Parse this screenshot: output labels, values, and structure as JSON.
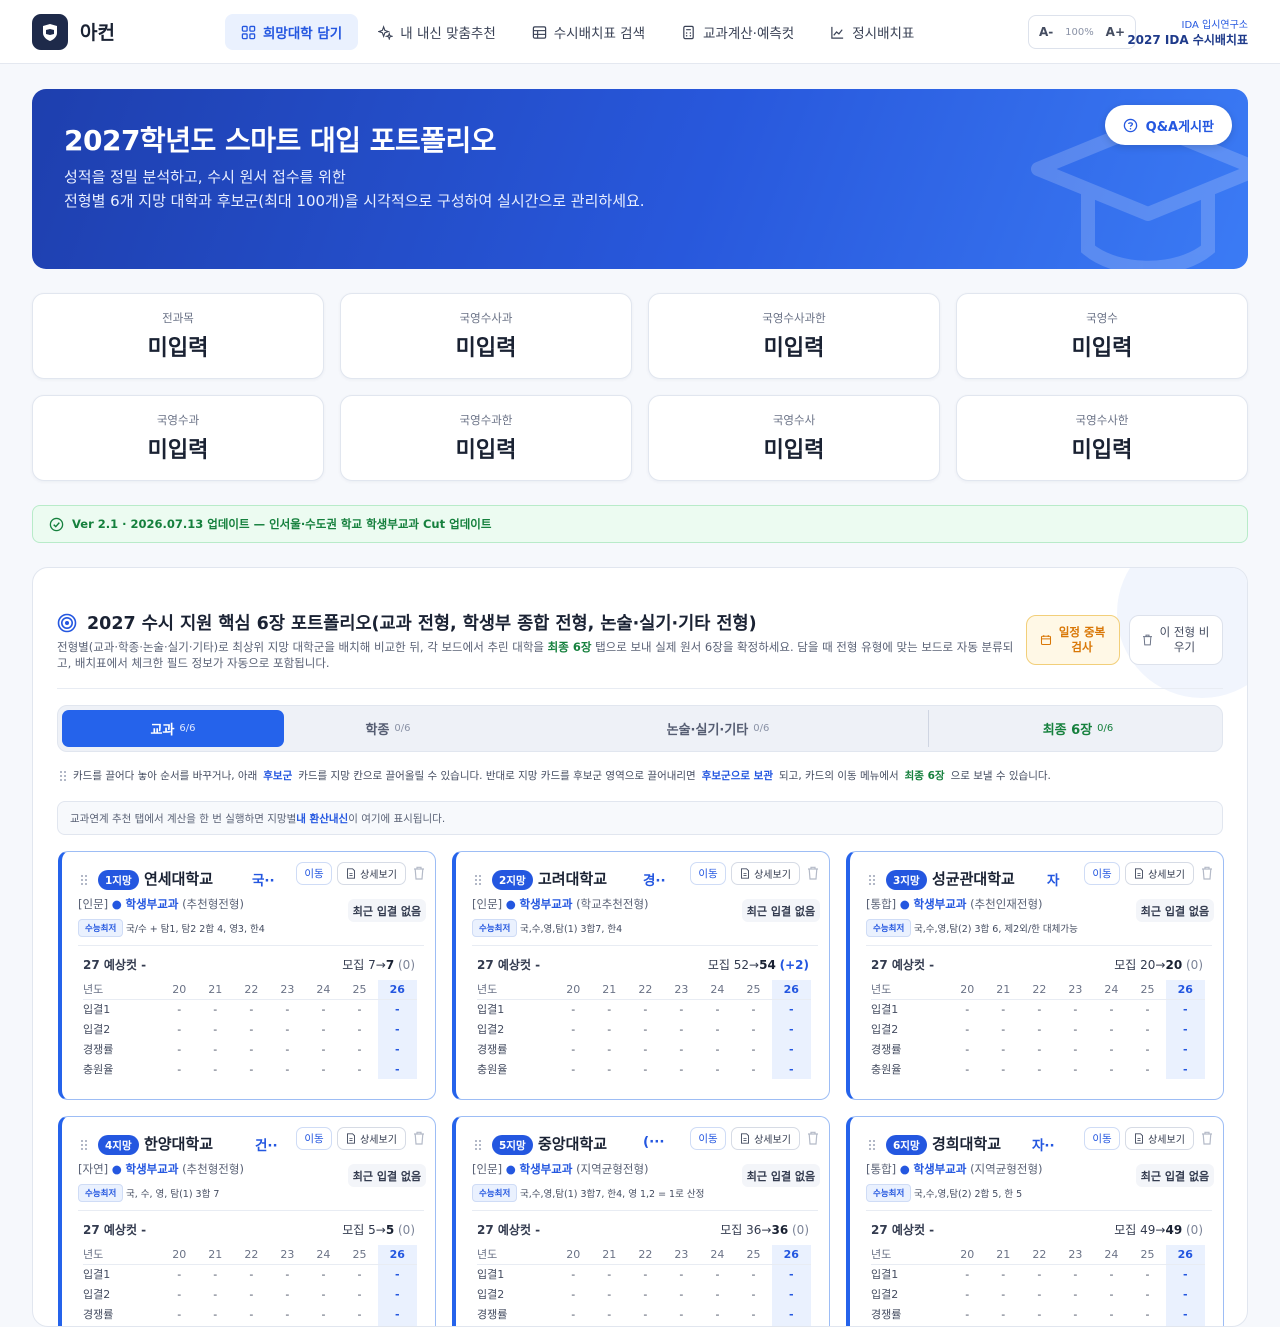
{
  "header": {
    "app_name": "아컨",
    "nav": [
      {
        "label": "희망대학 담기",
        "icon": "grid-icon",
        "active": true
      },
      {
        "label": "내 내신 맞춤추천",
        "icon": "sparkle-icon",
        "active": false
      },
      {
        "label": "수시배치표 검색",
        "icon": "table-icon",
        "active": false
      },
      {
        "label": "교과계산·예측컷",
        "icon": "calculator-icon",
        "active": false
      },
      {
        "label": "정시배치표",
        "icon": "chart-icon",
        "active": false
      }
    ],
    "zoom": {
      "decrease": "A-",
      "value": "100%",
      "increase": "A+"
    },
    "brand_sub": "IDA 입시연구소",
    "brand_main": "2027 IDA 수시배치표"
  },
  "hero": {
    "title": "2027학년도 스마트 대입 포트폴리오",
    "desc1": "성적을 정밀 분석하고, 수시 원서 접수를 위한",
    "desc2": "전형별 6개 지망 대학과 후보군(최대 100개)을 시각적으로 구성하여 실시간으로 관리하세요.",
    "qa_button": "Q&A게시판"
  },
  "stats": [
    {
      "label": "전과목",
      "value": "미입력"
    },
    {
      "label": "국영수사과",
      "value": "미입력"
    },
    {
      "label": "국영수사과한",
      "value": "미입력"
    },
    {
      "label": "국영수",
      "value": "미입력"
    },
    {
      "label": "국영수과",
      "value": "미입력"
    },
    {
      "label": "국영수과한",
      "value": "미입력"
    },
    {
      "label": "국영수사",
      "value": "미입력"
    },
    {
      "label": "국영수사한",
      "value": "미입력"
    }
  ],
  "update": "Ver 2.1 · 2026.07.13 업데이트 — 인서울·수도권 학교 학생부교과 Cut 업데이트",
  "portfolio": {
    "title": "2027 수시 지원 핵심 6장 포트폴리오(교과 전형, 학생부 종합 전형, 논술·실기·기타 전형)",
    "desc_a": "전형별(교과·학종·논술·실기·기타)로 최상위 지망 대학군을 배치해 비교한 뒤, 각 보드에서 추린 대학을 ",
    "desc_b": "최종 6장",
    "desc_c": " 탭으로 보내 실제 원서 6장을 확정하세요. 담을 때 전형 유형에 맞는 보드로 자동 분류되고, 배치표에서 체크한 필드 정보가 자동으로 포함됩니다.",
    "dup_button": "일정 중복 검사",
    "clear_button": "이 전형 비우기",
    "tabs": [
      {
        "label": "교과",
        "count": "6/6"
      },
      {
        "label": "학종",
        "count": "0/6"
      },
      {
        "label": "논술·실기·기타",
        "count": "0/6"
      },
      {
        "label": "최종 6장",
        "count": "0/6"
      }
    ],
    "hint": {
      "a": "카드를 끌어다 놓아 순서를 바꾸거나, 아래",
      "b": "후보군",
      "c": "카드를 지망 칸으로 끌어올릴 수 있습니다. 반대로 지망 카드를 후보군 영역으로 끌어내리면",
      "d": "후보군으로 보관",
      "e": "되고, 카드의  이동  메뉴에서",
      "f": "최종 6장",
      "g": "으로 보낼 수 있습니다."
    },
    "info": {
      "a": "교과연계 추천 탭에서 계산을 한 번 실행하면 지망별 ",
      "b": "내 환산내신",
      "c": "이 여기에 표시됩니다."
    }
  },
  "card_labels": {
    "move": "이동",
    "detail": "상세보기",
    "recent": "최근 입결 없음",
    "min_tag": "수능최저",
    "predicted": "27 예상컷 -",
    "recruit": "모집",
    "years": [
      "년도",
      "20",
      "21",
      "22",
      "23",
      "24",
      "25",
      "26"
    ],
    "rows": [
      "입결1",
      "입결2",
      "경쟁률",
      "충원율"
    ],
    "dash": "-"
  },
  "cards": [
    {
      "rank": "1지망",
      "name": "연세대학교",
      "region": "국··",
      "category": "[인문]",
      "track": "학생부교과",
      "type": "(추천형전형)",
      "min": "국/수 + 탐1, 탐2 2합 4, 영3, 한4",
      "from": "7",
      "to": "7",
      "delta": "(0)"
    },
    {
      "rank": "2지망",
      "name": "고려대학교",
      "region": "경··",
      "category": "[인문]",
      "track": "학생부교과",
      "type": "(학교추천전형)",
      "min": "국,수,영,탐(1) 3합7, 한4",
      "from": "52",
      "to": "54",
      "delta": "(+2)"
    },
    {
      "rank": "3지망",
      "name": "성균관대학교",
      "region": "자",
      "category": "[통합]",
      "track": "학생부교과",
      "type": "(추천인재전형)",
      "min": "국,수,영,탐(2) 3합 6, 제2외/한 대체가능",
      "from": "20",
      "to": "20",
      "delta": "(0)"
    },
    {
      "rank": "4지망",
      "name": "한양대학교",
      "region": "건··",
      "category": "[자연]",
      "track": "학생부교과",
      "type": "(추천형전형)",
      "min": "국, 수, 영, 탐(1) 3합 7",
      "from": "5",
      "to": "5",
      "delta": "(0)"
    },
    {
      "rank": "5지망",
      "name": "중앙대학교",
      "region": "(···",
      "category": "[인문]",
      "track": "학생부교과",
      "type": "(지역균형전형)",
      "min": "국,수,영,탐(1) 3합7, 한4, 영 1,2 = 1로 산정",
      "from": "36",
      "to": "36",
      "delta": "(0)"
    },
    {
      "rank": "6지망",
      "name": "경희대학교",
      "region": "자··",
      "category": "[통합]",
      "track": "학생부교과",
      "type": "(지역균형전형)",
      "min": "국,수,영,탐(2) 2합 5, 한 5",
      "from": "49",
      "to": "49",
      "delta": "(0)"
    }
  ]
}
